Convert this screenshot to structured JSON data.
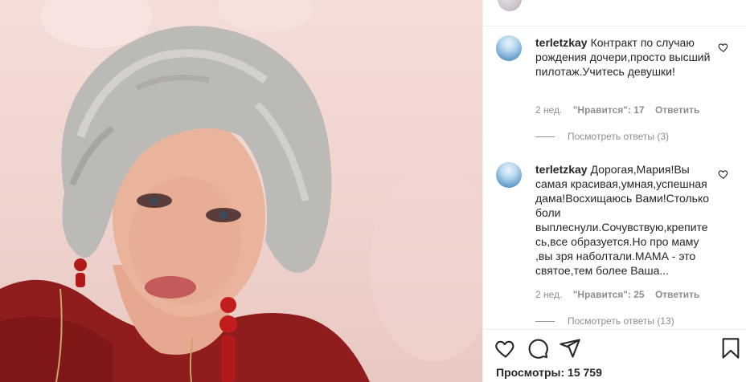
{
  "post_image": {
    "alt": "photo"
  },
  "comments": [
    {
      "username": "terletzkay",
      "text": "Контракт по случаю рождения дочери,просто высший пилотаж.Учитесь девушки!",
      "time": "2 нед.",
      "likes": "\"Нравится\": 17",
      "reply": "Ответить",
      "view_replies": "Посмотреть ответы (3)"
    },
    {
      "username": "terletzkay",
      "text": "Дорогая,Мария!Вы самая красивая,умная,успешная дама!Восхищаюсь Вами!Столько боли выплеснули.Сочувствую,крепитесь,все образуется.Но про маму ,вы зря наболтали.МАМА - это святое,тем более Ваша...",
      "time": "2 нед.",
      "likes": "\"Нравится\": 25",
      "reply": "Ответить",
      "view_replies": "Посмотреть ответы (13)"
    }
  ],
  "views": "Просмотры: 15 759",
  "icons": [
    "heart-icon",
    "comment-icon",
    "share-icon",
    "bookmark-icon"
  ],
  "colors": {
    "text": "#262626",
    "muted": "#8e8e8e",
    "border": "#efefef",
    "dress": "#8f1d1d"
  }
}
